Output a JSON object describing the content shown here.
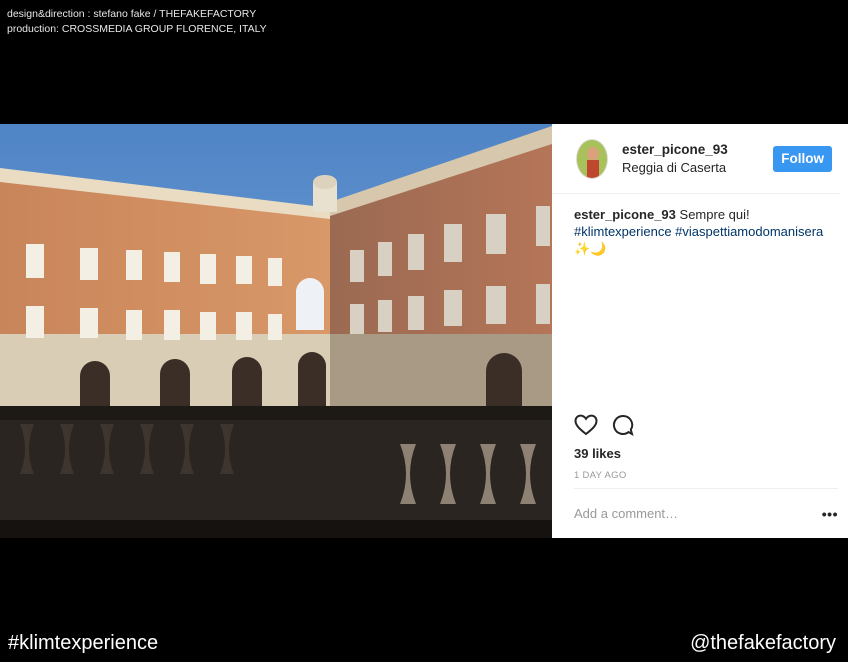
{
  "credits": {
    "line1": "design&direction : stefano fake / THEFAKEFACTORY",
    "line2": "production: CROSSMEDIA GROUP FLORENCE, ITALY"
  },
  "post": {
    "username": "ester_picone_93",
    "location": "Reggia di Caserta",
    "follow_label": "Follow",
    "caption_user": "ester_picone_93",
    "caption_text": "Sempre qui!",
    "caption_tags": "#klimtexperience #viaspettiamodomanisera",
    "caption_emoji": "✨🌙",
    "likes": "39 likes",
    "time_ago": "1 DAY AGO",
    "comment_placeholder": "Add a comment…",
    "more_label": "•••",
    "icons": [
      "heart-icon",
      "comment-icon"
    ]
  },
  "footer": {
    "hashtag": "#klimtexperience",
    "handle": "@thefakefactory"
  },
  "colors": {
    "follow": "#3897f0",
    "hashtag_link": "#003569",
    "background": "#000000"
  }
}
